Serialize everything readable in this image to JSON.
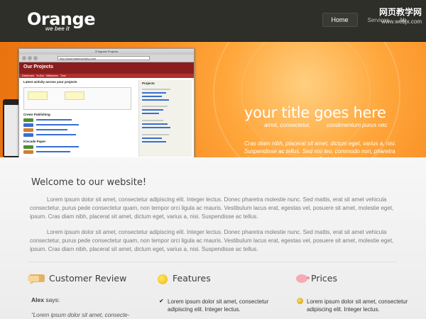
{
  "header": {
    "logo": "Orange",
    "tagline": "we bee it",
    "nav": [
      {
        "label": "Home",
        "active": true
      },
      {
        "label": "Services",
        "active": false
      },
      {
        "label": "Ab",
        "active": false
      }
    ],
    "watermark": "网页教学网",
    "watermark_url": "www.webjx.com"
  },
  "banner": {
    "title": "your title goes here",
    "subtitle_left": "amet, consectetur,",
    "subtitle_right": "condimentum purus nec",
    "text": "Cras diam nibh, placerat sit amet, dictum eget, varius a, nisi. Suspendisse ac tellus. Sed nisi leo, commodo non, pharetra sit amet, consequat ut, nunc. Sed nisi leo, commodo non, pharetra sit amet, consequat ut, nunc.",
    "mockup": {
      "window_title": "37signals Projects",
      "url": "http://www.basecamphq.com",
      "app_title": "Our Projects",
      "tabs": [
        "Dashboard",
        "To-Dos",
        "Milestones",
        "Time"
      ],
      "section_title": "Latest activity across your projects",
      "sidebar_title": "Projects",
      "group1": "Crews Publishing",
      "group2": "Kincade Paper"
    }
  },
  "content": {
    "welcome": "Welcome to our website!",
    "paragraph1": "Lorem ipsum dolor sit amet, consectetur adipiscing elit. Integer lectus. Donec pharetra molestie nunc. Sed mattis, erat sit amet vehicula consectetur, purus pede consectetur quam, non tempor orci ligula ac mauris. Vestibulum lacus erat, egestas vel, posuere sit amet, molestie eget, ipsum. Cras diam nibh, placerat sit amet, dictum eget, varius a, nisi. Suspendisse ac tellus.",
    "paragraph2": "Lorem ipsum dolor sit amet, consectetur adipiscing elit. Integer lectus. Donec pharetra molestie nunc. Sed mattis, erat sit amet vehicula consectetur, purus pede consectetur quam, non tempor orci ligula ac mauris. Vestibulum lacus erat, egestas vel, posuere sit amet, molestie eget, ipsum. Cras diam nibh, placerat sit amet, dictum eget, varius a, nisi. Suspendisse ac tellus.",
    "columns": {
      "review": {
        "title": "Customer Review",
        "author": "Alex",
        "says": "says:",
        "quote": "“Lorem ipsum dolor sit amet, consecte-"
      },
      "features": {
        "title": "Features",
        "item": "Lorem ipsum dolor sit amet, consectetur adipiscing elit. Integer lectus."
      },
      "prices": {
        "title": "Prices",
        "item": "Lorem ipsum dolor sit amet, consectetur adipiscing elit. Integer lectus."
      }
    }
  },
  "colors": {
    "header_bg": "#2f2f2a",
    "banner_orange": "#f6891f",
    "text_dark": "#3c3c3c"
  }
}
